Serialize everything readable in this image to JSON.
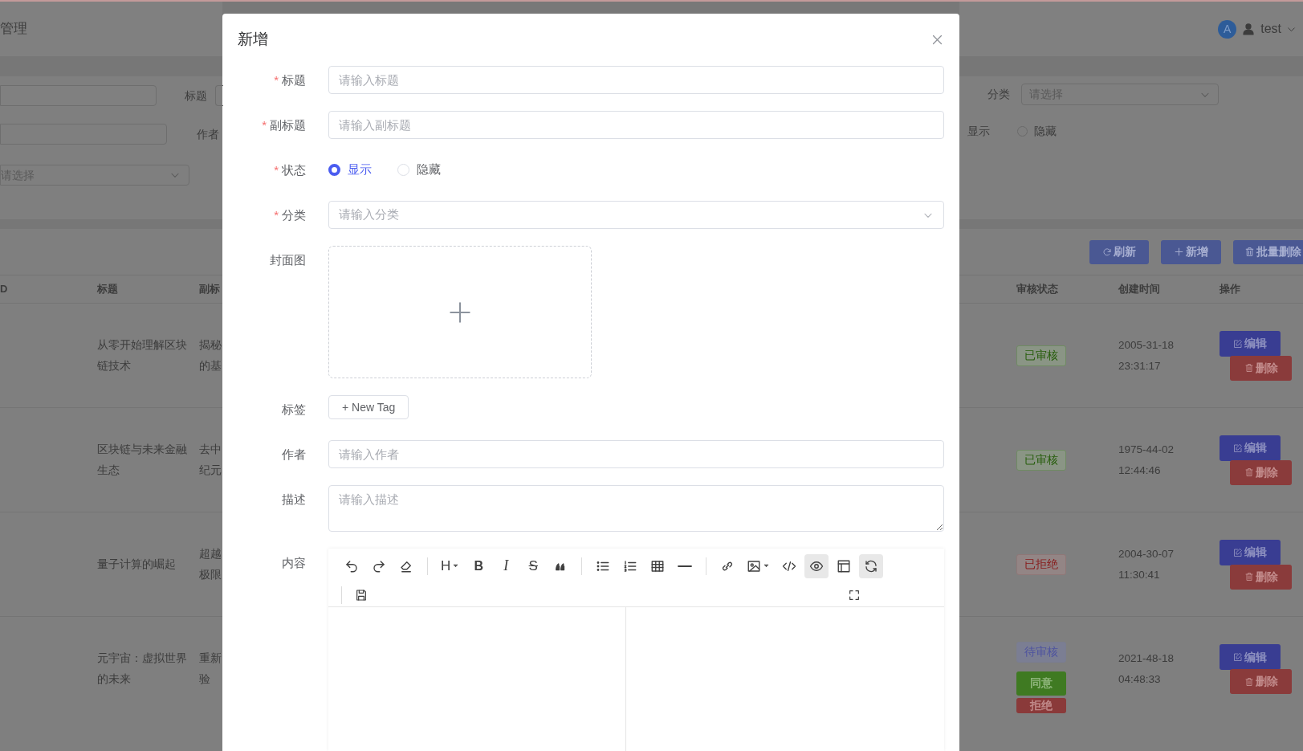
{
  "header": {
    "title": "管理",
    "avatar": "A",
    "user": "test"
  },
  "search_form": {
    "left_labels": [
      "标题",
      "作者"
    ],
    "left_select_placeholder": "请选择",
    "category_label": "分类",
    "category_placeholder": "请选择",
    "status_options": [
      {
        "label": "显示"
      },
      {
        "label": "隐藏",
        "selected": false
      }
    ]
  },
  "toolbar": [
    {
      "kind": "refresh",
      "label": "刷新"
    },
    {
      "kind": "add",
      "label": "新增"
    },
    {
      "kind": "delete",
      "label": "批量删除"
    }
  ],
  "table": {
    "columns_left": [
      "D",
      "标题",
      "副标"
    ],
    "columns_right": [
      "审核状态",
      "创建时间",
      "操作"
    ],
    "rows": [
      {
        "title_lines": [
          "从零开始理解区块",
          "链技术"
        ],
        "subtitle_lines": [
          "揭秘",
          "的基"
        ],
        "status": [
          {
            "kind": "approved",
            "label": "已审核"
          }
        ],
        "created": [
          "2005-31-18",
          "23:31:17"
        ],
        "actions": [
          "编辑",
          "删除"
        ]
      },
      {
        "title_lines": [
          "区块链与未来金融",
          "生态"
        ],
        "subtitle_lines": [
          "去中",
          "纪元"
        ],
        "status": [
          {
            "kind": "approved",
            "label": "已审核"
          }
        ],
        "created": [
          "1975-44-02",
          "12:44:46"
        ],
        "actions": [
          "编辑",
          "删除"
        ]
      },
      {
        "title_lines": [
          "量子计算的崛起"
        ],
        "subtitle_lines": [
          "超越",
          "极限"
        ],
        "status": [
          {
            "kind": "rejected",
            "label": "已拒绝"
          }
        ],
        "created": [
          "2004-30-07",
          "11:30:41"
        ],
        "actions": [
          "编辑",
          "删除"
        ]
      },
      {
        "title_lines": [
          "元宇宙：虚拟世界",
          "的未来"
        ],
        "subtitle_lines": [
          "重新",
          "验"
        ],
        "status": [
          {
            "kind": "pending",
            "label": "待审核"
          },
          {
            "kind": "agree",
            "label": "同意"
          },
          {
            "kind": "reject",
            "label": "拒绝"
          }
        ],
        "created": [
          "2021-48-18",
          "04:48:33"
        ],
        "actions": [
          "编辑",
          "删除"
        ]
      }
    ]
  },
  "dialog": {
    "title": "新增",
    "fields": [
      {
        "kind": "input",
        "label": "标题",
        "mark": "*",
        "placeholder": "请输入标题"
      },
      {
        "kind": "input",
        "label": "副标题",
        "mark": "*",
        "placeholder": "请输入副标题"
      },
      {
        "kind": "radio",
        "label": "状态",
        "mark": "*",
        "options": [
          {
            "label": "显示",
            "selected": true
          },
          {
            "label": "隐藏",
            "selected": false
          }
        ]
      },
      {
        "kind": "select",
        "label": "分类",
        "mark": "*",
        "placeholder": "请输入分类"
      },
      {
        "kind": "upload",
        "label": "封面图"
      },
      {
        "kind": "tags",
        "label": "标签",
        "button": "+ New Tag"
      },
      {
        "kind": "input",
        "label": "作者",
        "placeholder": "请输入作者"
      },
      {
        "kind": "textarea",
        "label": "描述",
        "placeholder": "请输入描述"
      },
      {
        "kind": "editor",
        "label": "内容",
        "tools": [
          {
            "kind": "undo",
            "active": false
          },
          {
            "kind": "redo",
            "active": false
          },
          {
            "kind": "eraser",
            "active": false
          },
          {
            "kind": "separator"
          },
          {
            "kind": "heading",
            "text": "H",
            "active": false
          },
          {
            "kind": "bold",
            "text": "B",
            "active": false
          },
          {
            "kind": "italic",
            "text": "I",
            "active": false
          },
          {
            "kind": "strike",
            "text": "S",
            "active": false
          },
          {
            "kind": "quote",
            "active": false
          },
          {
            "kind": "separator"
          },
          {
            "kind": "bullet-list",
            "active": false
          },
          {
            "kind": "numbered-list",
            "active": false
          },
          {
            "kind": "table",
            "active": false
          },
          {
            "kind": "rule",
            "active": false
          },
          {
            "kind": "separator"
          },
          {
            "kind": "link",
            "active": false
          },
          {
            "kind": "image",
            "active": false
          },
          {
            "kind": "code",
            "active": false
          },
          {
            "kind": "preview",
            "active": true
          },
          {
            "kind": "layout",
            "active": false
          },
          {
            "kind": "sync",
            "active": true
          }
        ],
        "tools_row2": [
          {
            "kind": "save",
            "active": false
          },
          {
            "kind": "fullscreen",
            "active": false
          }
        ]
      }
    ]
  }
}
